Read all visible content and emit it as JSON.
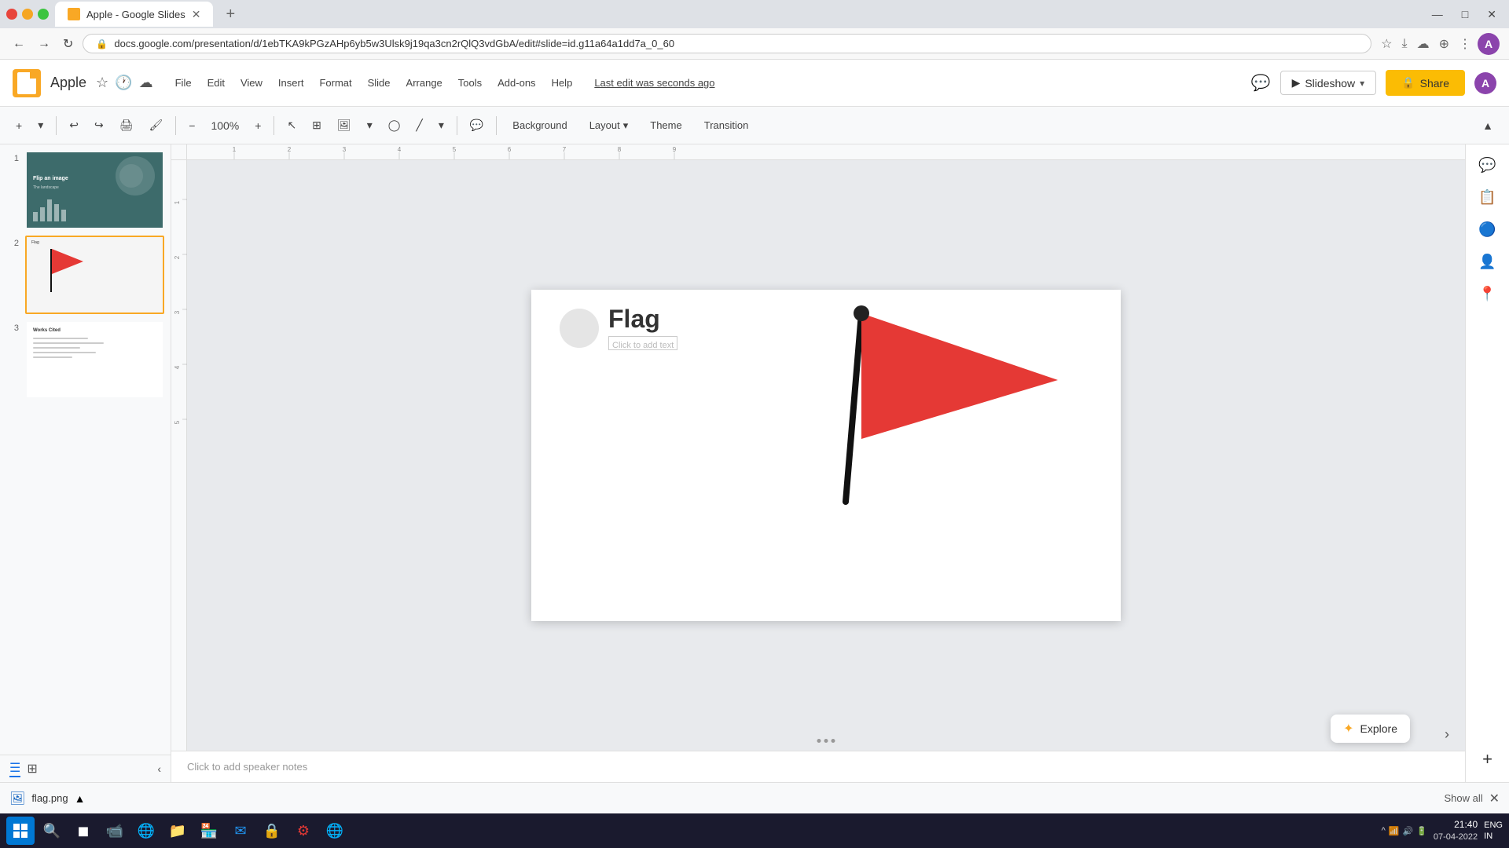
{
  "browser": {
    "tab_title": "Apple - Google Slides",
    "tab_favicon": "slides",
    "url": "docs.google.com/presentation/d/1ebTKA9kPGzAHp6yb5w3Ulsk9j19qa3cn2rQlQ3vdGbA/edit#slide=id.g11a64a1dd7a_0_60",
    "url_full": "https://docs.google.com/presentation/d/1ebTKA9kPGzAHp6yb5w3Ulsk9j19qa3cn2rQlQ3vdGbA/edit#slide=id.g11a64a1dd7a_0_60"
  },
  "window_controls": {
    "minimize": "—",
    "maximize": "□",
    "close": "✕"
  },
  "app": {
    "title": "Apple",
    "last_edit": "Last edit was seconds ago"
  },
  "menu": {
    "items": [
      "File",
      "Edit",
      "View",
      "Insert",
      "Format",
      "Slide",
      "Arrange",
      "Tools",
      "Add-ons",
      "Help"
    ]
  },
  "toolbar": {
    "background_label": "Background",
    "layout_label": "Layout",
    "theme_label": "Theme",
    "transition_label": "Transition"
  },
  "slides": [
    {
      "number": "1",
      "type": "flip-image"
    },
    {
      "number": "2",
      "type": "flag",
      "active": true
    },
    {
      "number": "3",
      "type": "works-cited"
    }
  ],
  "slide_1": {
    "title": "Flip an image",
    "bars": [
      3,
      5,
      8,
      6,
      4
    ]
  },
  "slide_2": {
    "title": "Flag",
    "subtitle": "Click to add text"
  },
  "slide_3": {
    "title": "Works Cited",
    "lines": [
      70,
      90,
      60,
      80,
      50
    ]
  },
  "main_slide": {
    "title": "Flag",
    "subtitle_placeholder": "Click to add text"
  },
  "header_buttons": {
    "slideshow": "Slideshow",
    "share": "Share",
    "explore": "Explore"
  },
  "notes": {
    "placeholder": "Click to add speaker notes"
  },
  "file_bar": {
    "filename": "flag.png",
    "show_all": "Show all",
    "close_label": "✕"
  },
  "taskbar": {
    "time": "21:40",
    "date": "07-04-2022",
    "language": "ENG\nIN"
  },
  "right_panel_icons": [
    "💬",
    "📋",
    "🔵",
    "👤",
    "📍"
  ],
  "taskbar_apps": [
    "⊞",
    "🔍",
    "◼",
    "📹",
    "🌐",
    "📁",
    "🏪",
    "✉",
    "🔒",
    "⚙",
    "🌐"
  ]
}
